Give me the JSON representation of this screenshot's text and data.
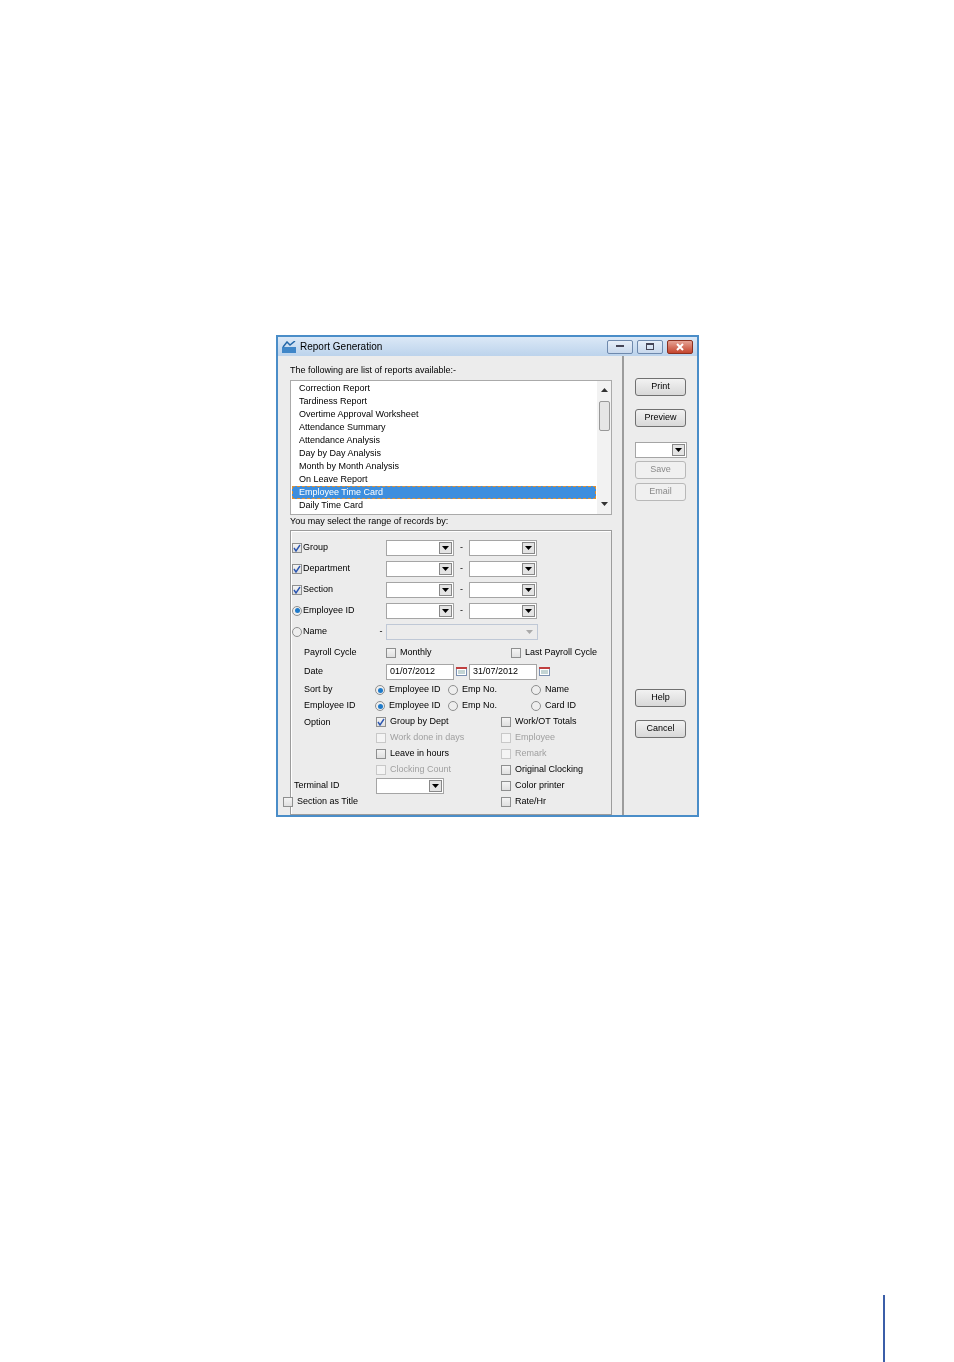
{
  "window": {
    "title": "Report Generation"
  },
  "reports_label": "The following are list of reports available:-",
  "reports": [
    {
      "label": "Correction Report",
      "selected": false
    },
    {
      "label": "Tardiness Report",
      "selected": false
    },
    {
      "label": "Overtime Approval Worksheet",
      "selected": false
    },
    {
      "label": "Attendance Summary",
      "selected": false
    },
    {
      "label": "Attendance Analysis",
      "selected": false
    },
    {
      "label": "Day by Day Analysis",
      "selected": false
    },
    {
      "label": "Month by Month Analysis",
      "selected": false
    },
    {
      "label": "On Leave Report",
      "selected": false
    },
    {
      "label": "Employee Time Card",
      "selected": true
    },
    {
      "label": "Daily Time Card",
      "selected": false
    }
  ],
  "range_label": "You may select the range of records by:",
  "range_rows": [
    {
      "kind": "checkbox",
      "label": "Group",
      "checked": true,
      "range": true,
      "dash": "-"
    },
    {
      "kind": "checkbox",
      "label": "Department",
      "checked": true,
      "range": true,
      "dash": "-"
    },
    {
      "kind": "checkbox",
      "label": "Section",
      "checked": true,
      "range": true,
      "dash": "-"
    },
    {
      "kind": "radio",
      "label": "Employee ID",
      "selected": true,
      "range": true,
      "dash": "-"
    },
    {
      "kind": "radio",
      "label": "Name",
      "selected": false,
      "range": false,
      "dash": "-"
    }
  ],
  "payroll_cycle": {
    "label": "Payroll Cycle",
    "options": [
      {
        "label": "Monthly",
        "checked": false
      },
      {
        "label": "Last Payroll Cycle",
        "checked": false
      }
    ]
  },
  "date": {
    "label": "Date",
    "from": "01/07/2012",
    "to": "31/07/2012"
  },
  "sort_by": {
    "label": "Sort by",
    "options": [
      {
        "label": "Employee ID",
        "selected": true
      },
      {
        "label": "Emp No.",
        "selected": false
      },
      {
        "label": "Name",
        "selected": false
      }
    ]
  },
  "employee_id": {
    "label": "Employee ID",
    "options": [
      {
        "label": "Employee ID",
        "selected": true
      },
      {
        "label": "Emp No.",
        "selected": false
      },
      {
        "label": "Card ID",
        "selected": false
      }
    ]
  },
  "option": {
    "label": "Option",
    "left": [
      {
        "label": "Group by Dept",
        "checked": true,
        "disabled": false
      },
      {
        "label": "Work done in days",
        "checked": false,
        "disabled": true
      },
      {
        "label": "Leave in hours",
        "checked": false,
        "disabled": false
      },
      {
        "label": "Clocking Count",
        "checked": false,
        "disabled": true
      }
    ],
    "right": [
      {
        "label": "Work/OT Totals",
        "checked": false,
        "disabled": false
      },
      {
        "label": "Employee",
        "checked": false,
        "disabled": true
      },
      {
        "label": "Remark",
        "checked": false,
        "disabled": true
      },
      {
        "label": "Original Clocking",
        "checked": false,
        "disabled": false
      },
      {
        "label": "Color printer",
        "checked": false,
        "disabled": false
      },
      {
        "label": "Rate/Hr",
        "checked": false,
        "disabled": false
      }
    ]
  },
  "terminal": {
    "label": "Terminal ID"
  },
  "section_title": {
    "label": "Section as Title",
    "checked": false
  },
  "actions": [
    {
      "label": "Print",
      "disabled": false
    },
    {
      "label": "Preview",
      "disabled": false
    }
  ],
  "export_buttons": [
    {
      "label": "Save",
      "disabled": true
    },
    {
      "label": "Email",
      "disabled": true
    }
  ],
  "footer_buttons": [
    {
      "label": "Help",
      "disabled": false
    },
    {
      "label": "Cancel",
      "disabled": false
    }
  ]
}
